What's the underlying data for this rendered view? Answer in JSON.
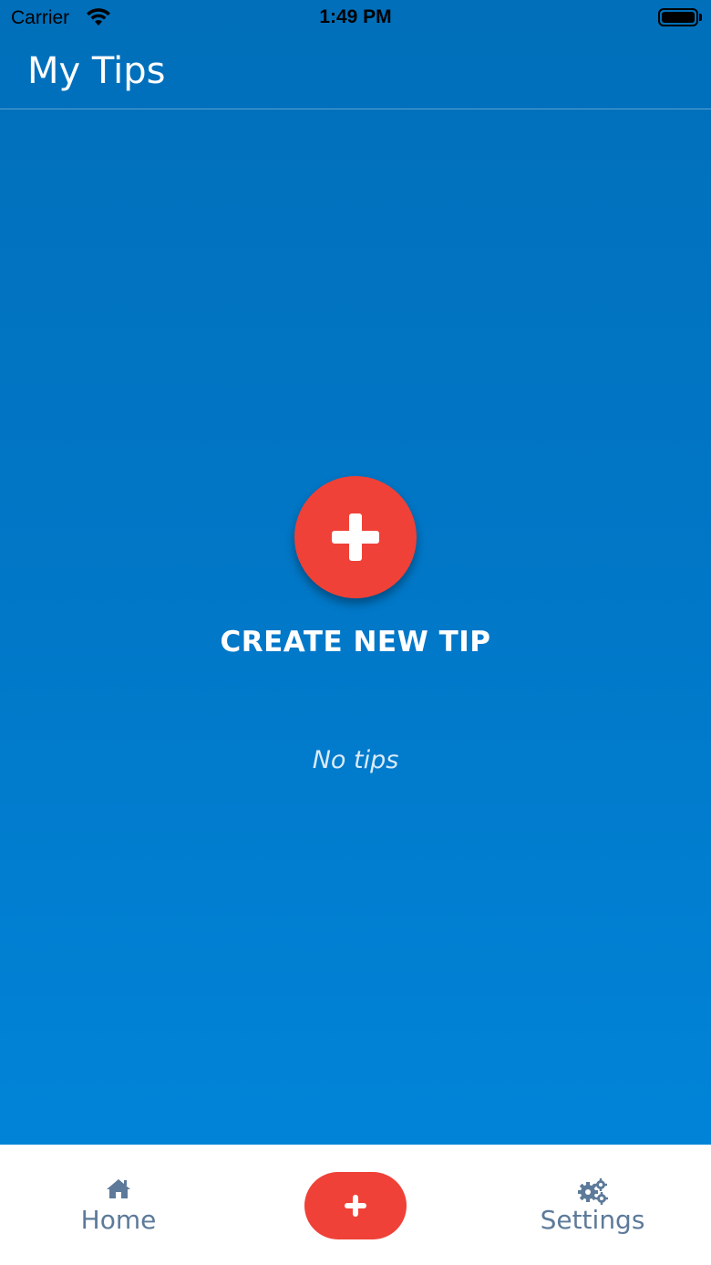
{
  "status_bar": {
    "carrier": "Carrier",
    "time": "1:49 PM",
    "icons": [
      "wifi-icon",
      "battery-icon"
    ]
  },
  "header": {
    "title": "My Tips"
  },
  "main": {
    "create_button_icon": "plus-icon",
    "create_label": "CREATE NEW TIP",
    "empty_state": "No tips"
  },
  "tab_bar": {
    "home": {
      "label": "Home",
      "icon": "home-icon"
    },
    "create": {
      "icon": "plus-icon"
    },
    "settings": {
      "label": "Settings",
      "icon": "gears-icon"
    }
  },
  "colors": {
    "background_top": "#016fba",
    "background_bottom": "#0184d8",
    "accent_red": "#ef4137",
    "tab_text": "#5d7a9a"
  }
}
